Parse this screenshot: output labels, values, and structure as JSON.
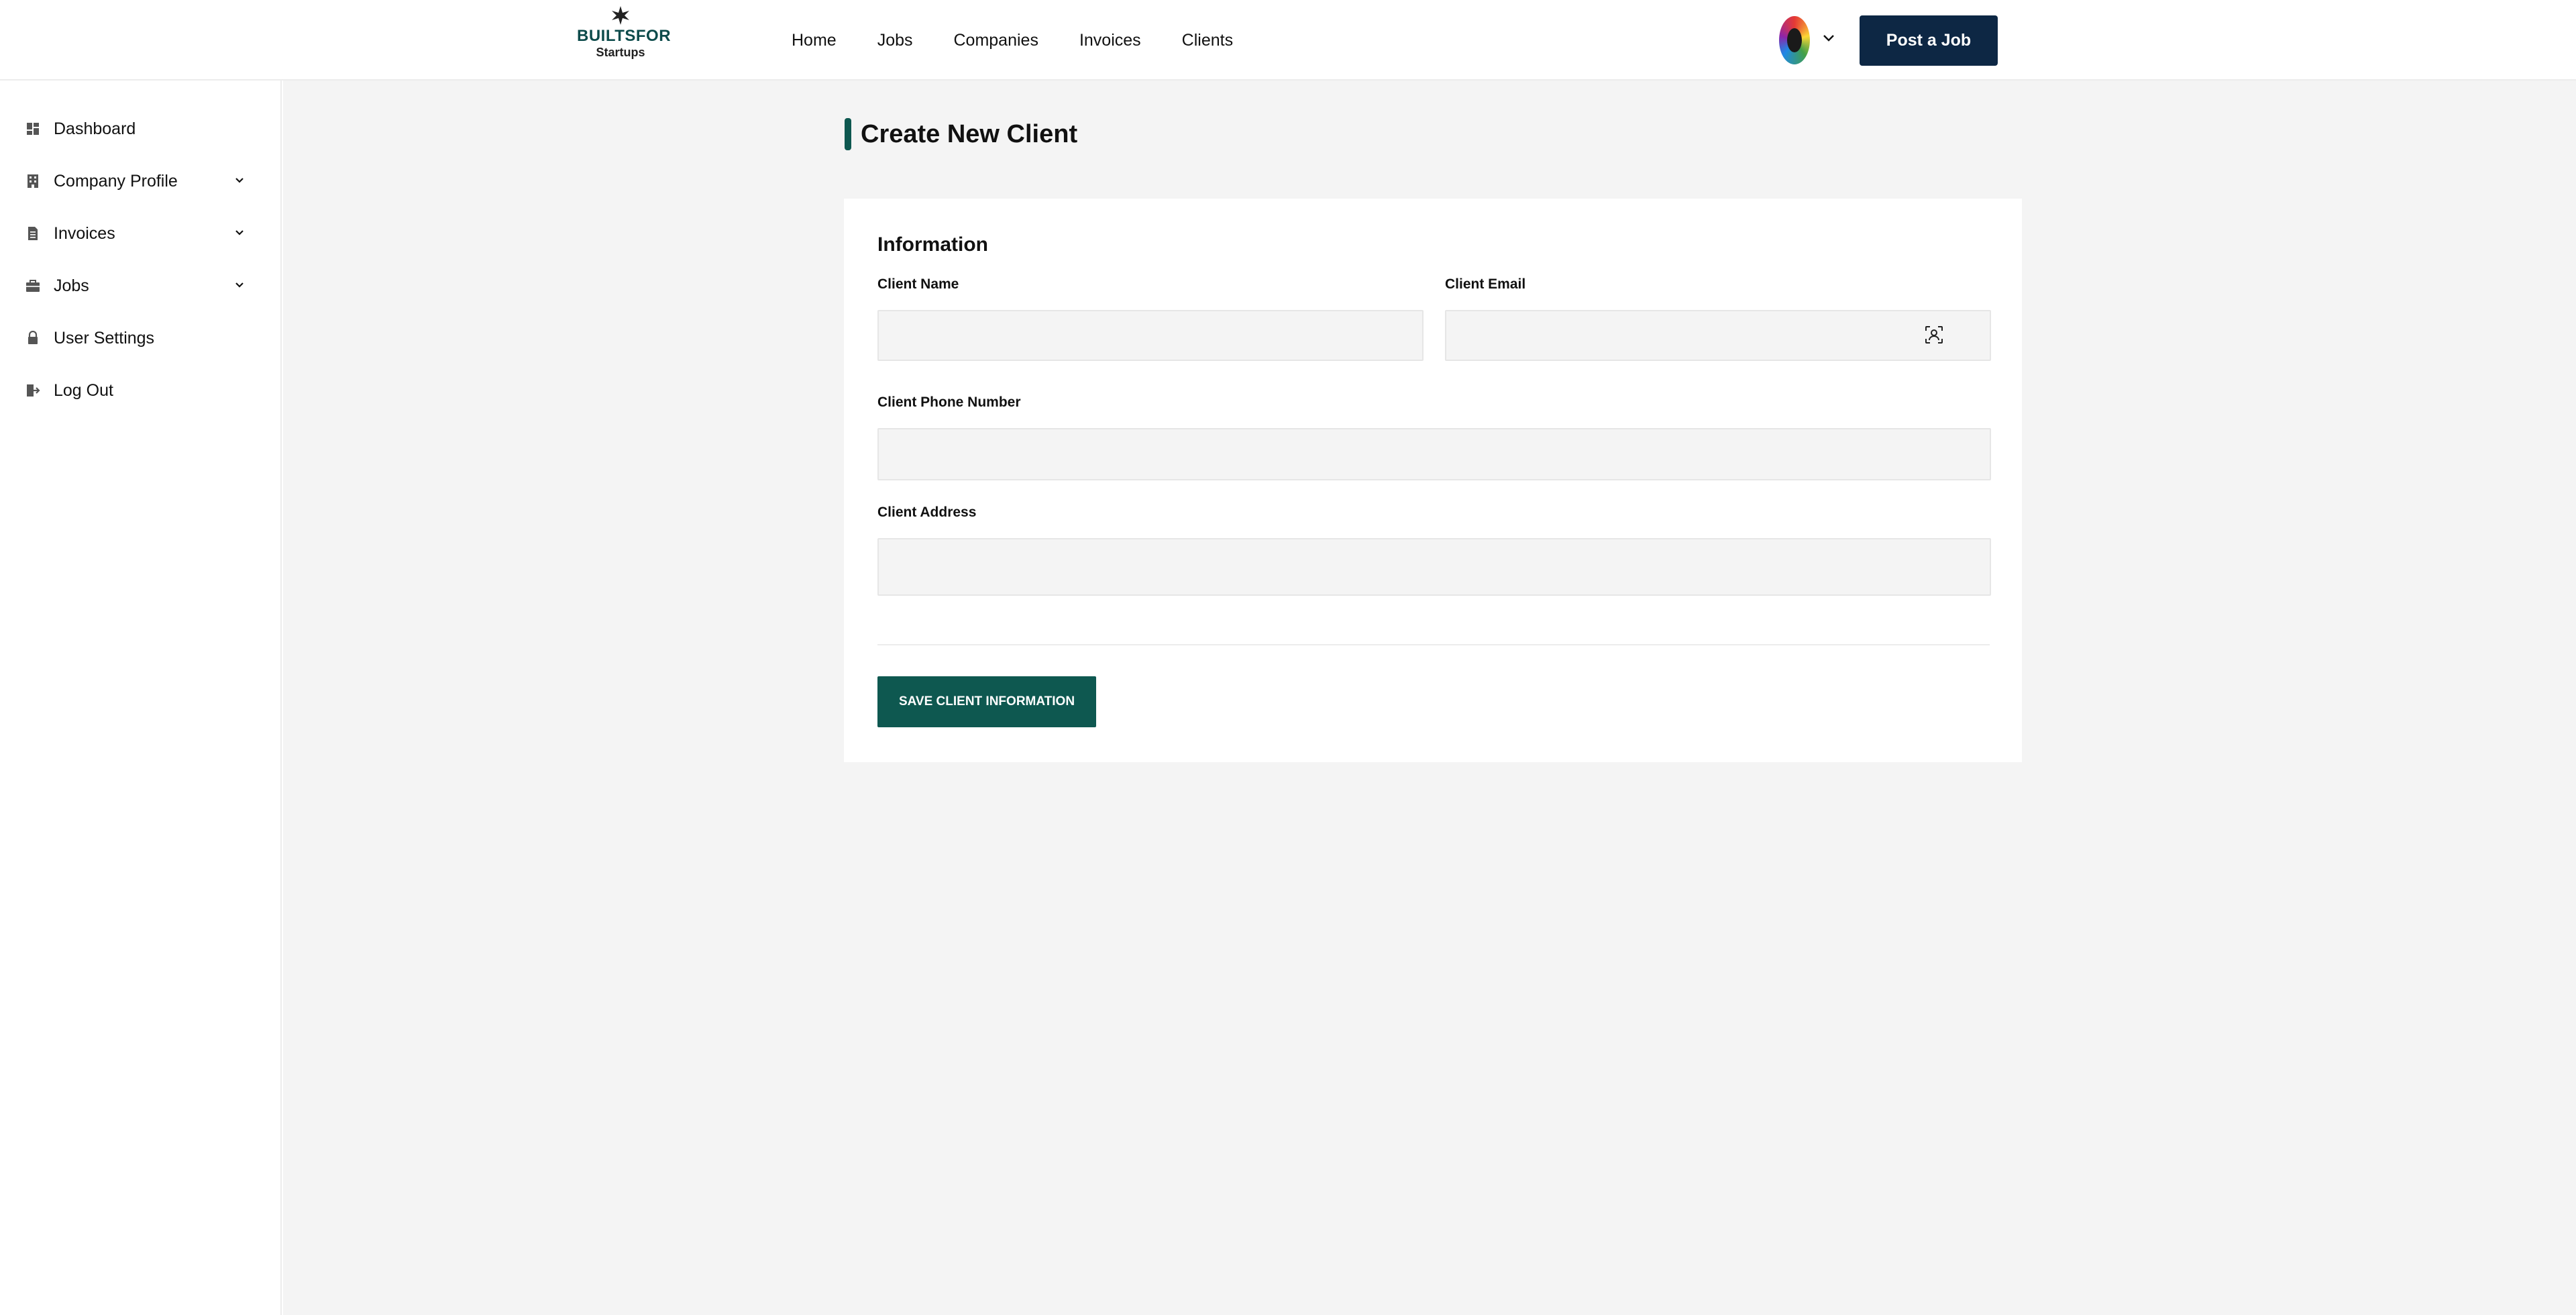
{
  "header": {
    "logo_top": "BUILTSFOR",
    "logo_bottom": "Startups",
    "nav": [
      "Home",
      "Jobs",
      "Companies",
      "Invoices",
      "Clients"
    ],
    "post_job_label": "Post a Job"
  },
  "sidebar": {
    "items": [
      {
        "label": "Dashboard",
        "icon": "dashboard-icon",
        "expandable": false
      },
      {
        "label": "Company Profile",
        "icon": "building-icon",
        "expandable": true
      },
      {
        "label": "Invoices",
        "icon": "document-icon",
        "expandable": true
      },
      {
        "label": "Jobs",
        "icon": "briefcase-icon",
        "expandable": true
      },
      {
        "label": "User Settings",
        "icon": "lock-icon",
        "expandable": false
      },
      {
        "label": "Log Out",
        "icon": "logout-icon",
        "expandable": false
      }
    ]
  },
  "page": {
    "title": "Create New Client"
  },
  "form": {
    "section_title": "Information",
    "client_name_label": "Client Name",
    "client_name_value": "",
    "client_email_label": "Client Email",
    "client_email_value": "",
    "client_phone_label": "Client Phone Number",
    "client_phone_value": "",
    "client_address_label": "Client Address",
    "client_address_value": "",
    "save_label": "SAVE CLIENT INFORMATION"
  },
  "colors": {
    "brand_teal": "#0e5850",
    "navy_button": "#0d2744",
    "page_background": "#f4f4f4"
  }
}
